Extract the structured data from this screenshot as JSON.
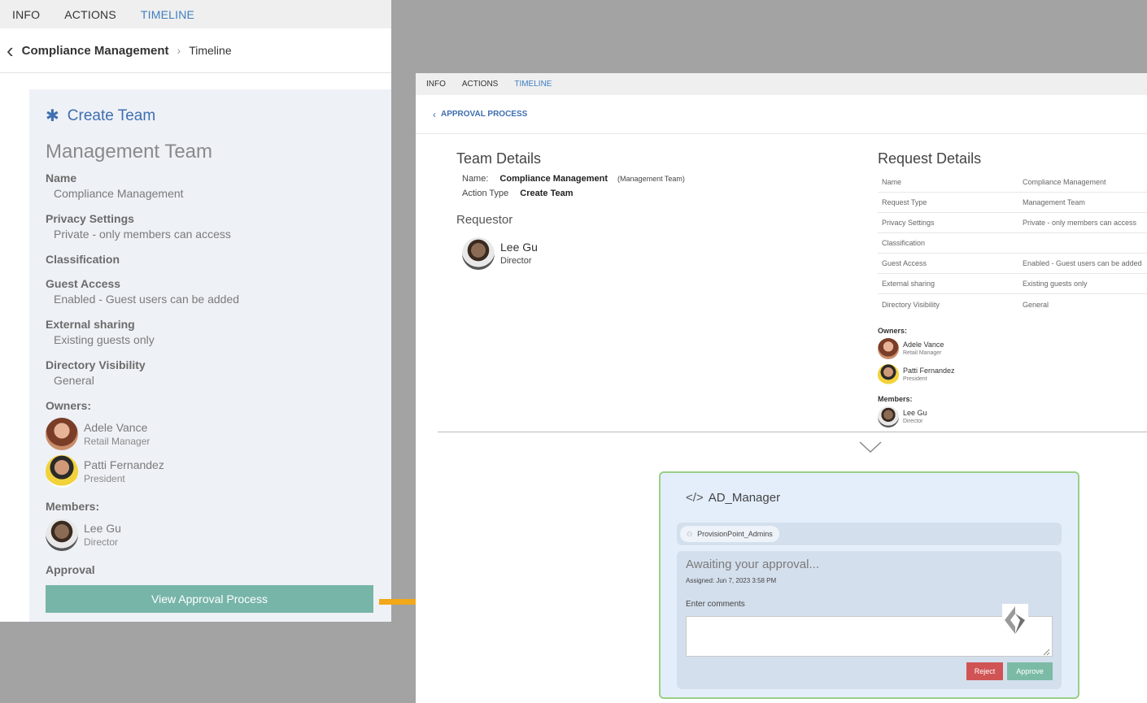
{
  "left": {
    "tabs": [
      "INFO",
      "ACTIONS",
      "TIMELINE"
    ],
    "breadcrumb": {
      "parent": "Compliance Management",
      "current": "Timeline"
    },
    "card": {
      "action_title": "Create Team",
      "team_type": "Management Team",
      "fields": [
        {
          "label": "Name",
          "value": "Compliance Management"
        },
        {
          "label": "Privacy Settings",
          "value": "Private - only members can access"
        },
        {
          "label": "Classification",
          "value": ""
        },
        {
          "label": "Guest Access",
          "value": "Enabled - Guest users can be added"
        },
        {
          "label": "External sharing",
          "value": "Existing guests only"
        },
        {
          "label": "Directory Visibility",
          "value": "General"
        }
      ],
      "owners_label": "Owners:",
      "owners": [
        {
          "name": "Adele Vance",
          "role": "Retail Manager"
        },
        {
          "name": "Patti Fernandez",
          "role": "President"
        }
      ],
      "members_label": "Members:",
      "members": [
        {
          "name": "Lee Gu",
          "role": "Director"
        }
      ],
      "approval_label": "Approval",
      "view_button": "View Approval Process"
    }
  },
  "right": {
    "tabs": [
      "INFO",
      "ACTIONS",
      "TIMELINE"
    ],
    "breadcrumb": "APPROVAL PROCESS",
    "team_details": {
      "title": "Team Details",
      "name_key": "Name:",
      "name_value": "Compliance Management",
      "name_sub": "(Management Team)",
      "action_key": "Action Type",
      "action_value": "Create Team"
    },
    "requestor": {
      "title": "Requestor",
      "name": "Lee Gu",
      "role": "Director"
    },
    "request_details": {
      "title": "Request Details",
      "rows": [
        {
          "k": "Name",
          "v": "Compliance Management"
        },
        {
          "k": "Request Type",
          "v": "Management Team"
        },
        {
          "k": "Privacy Settings",
          "v": "Private - only members can access"
        },
        {
          "k": "Classification",
          "v": ""
        },
        {
          "k": "Guest Access",
          "v": "Enabled - Guest users can be added"
        },
        {
          "k": "External sharing",
          "v": "Existing guests only"
        },
        {
          "k": "Directory Visibility",
          "v": "General"
        }
      ],
      "owners_label": "Owners:",
      "owners": [
        {
          "name": "Adele Vance",
          "role": "Retail Manager"
        },
        {
          "name": "Patti Fernandez",
          "role": "President"
        }
      ],
      "members_label": "Members:",
      "members": [
        {
          "name": "Lee Gu",
          "role": "Director"
        }
      ]
    },
    "approval": {
      "title": "AD_Manager",
      "group": "ProvisionPoint_Admins",
      "status": "Awaiting your approval...",
      "assigned": "Assigned: Jun 7, 2023 3:58 PM",
      "comments_label": "Enter comments",
      "reject": "Reject",
      "approve": "Approve"
    }
  },
  "colors": {
    "accent": "#3f7fc1",
    "approve": "#7bbba6",
    "reject": "#d05454",
    "view_button": "#77b5a9",
    "arrow": "#f2a818",
    "highlight_border": "#9bcf86"
  }
}
